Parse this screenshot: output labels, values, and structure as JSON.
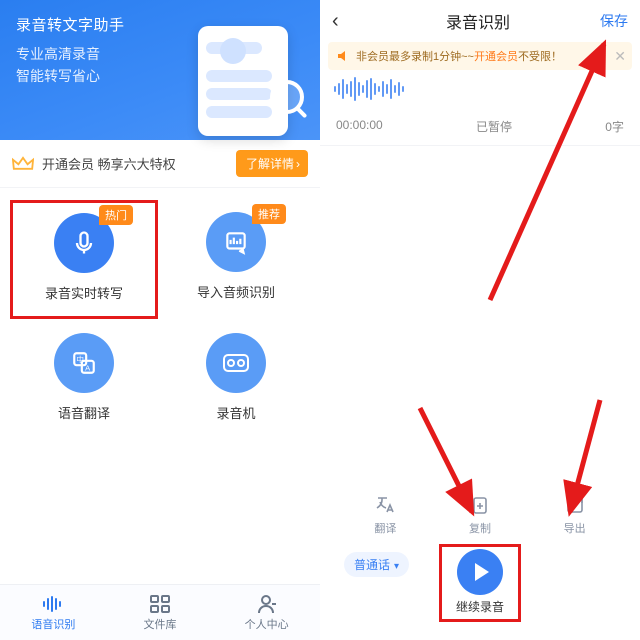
{
  "left": {
    "banner": {
      "title": "录音转文字助手",
      "line1": "专业高清录音",
      "line2": "智能转写省心"
    },
    "vip": {
      "text": "开通会员 畅享六大特权",
      "button": "了解详情"
    },
    "features": [
      {
        "label": "录音实时转写",
        "badge": "热门",
        "icon": "mic"
      },
      {
        "label": "导入音频识别",
        "badge": "推荐",
        "icon": "import"
      },
      {
        "label": "语音翻译",
        "badge": "",
        "icon": "translate"
      },
      {
        "label": "录音机",
        "badge": "",
        "icon": "recorder"
      }
    ],
    "tabs": [
      {
        "label": "语音识别"
      },
      {
        "label": "文件库"
      },
      {
        "label": "个人中心"
      }
    ]
  },
  "right": {
    "nav": {
      "title": "录音识别",
      "save": "保存"
    },
    "notice": {
      "text": "非会员最多录制1分钟~~",
      "link": "开通会员",
      "tail": "不受限！"
    },
    "meta": {
      "time": "00:00:00",
      "status": "已暂停",
      "words": "0字"
    },
    "actions": [
      {
        "label": "翻译"
      },
      {
        "label": "复制"
      },
      {
        "label": "导出"
      }
    ],
    "lang": "普通话",
    "record_button": "继续录音"
  }
}
